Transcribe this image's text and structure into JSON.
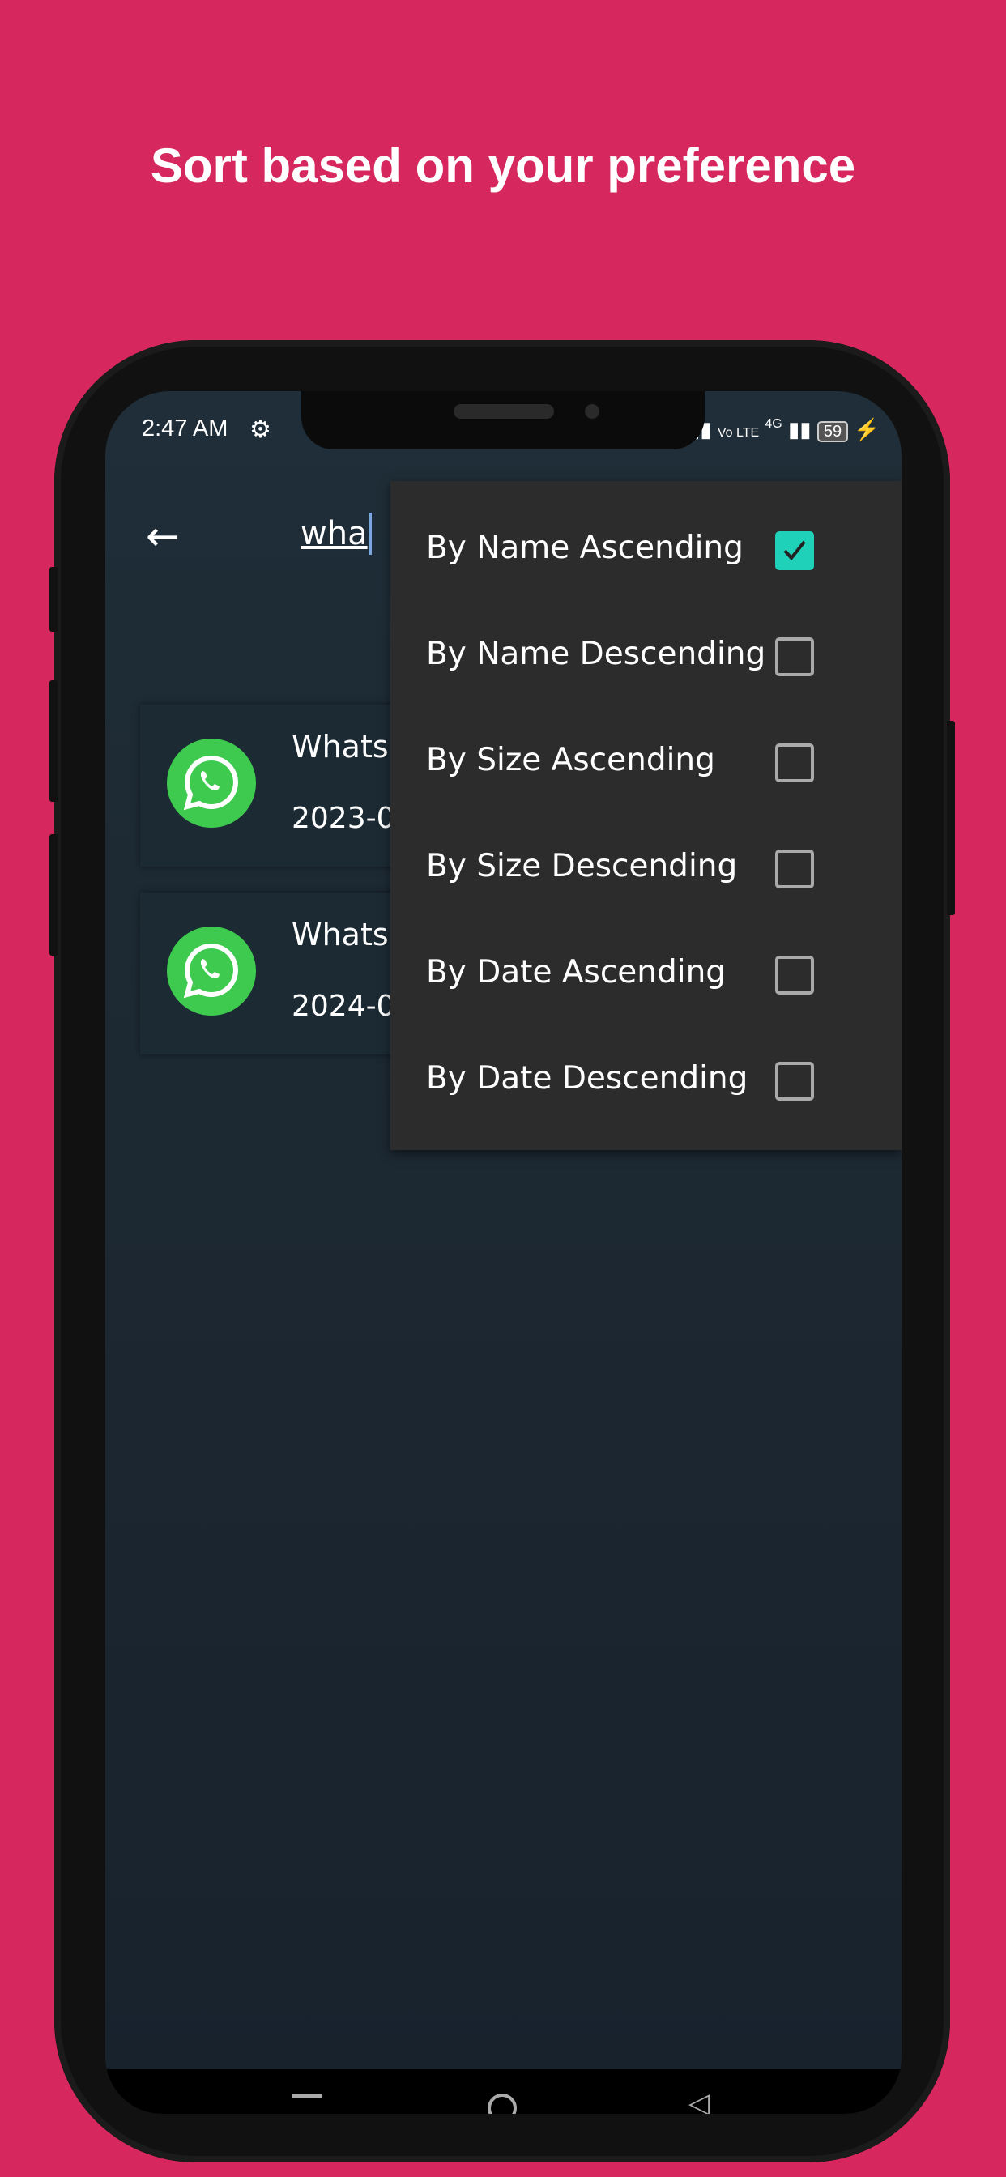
{
  "headline": "Sort based on your preference",
  "status": {
    "time": "2:47 AM",
    "network": "Vo LTE",
    "network_gen": "4G",
    "battery": "59"
  },
  "search": {
    "value": "wha"
  },
  "files": [
    {
      "name": "Whats.",
      "date": "2023-0"
    },
    {
      "name": "Whats.",
      "date": "2024-0"
    }
  ],
  "sort_menu": {
    "items": [
      {
        "label": "By Name Ascending",
        "checked": true
      },
      {
        "label": "By Name Descending",
        "checked": false
      },
      {
        "label": "By Size Ascending",
        "checked": false
      },
      {
        "label": "By Size Descending",
        "checked": false
      },
      {
        "label": "By Date Ascending",
        "checked": false
      },
      {
        "label": "By Date Descending",
        "checked": false
      }
    ]
  },
  "colors": {
    "background": "#D6285F",
    "accent": "#1fd1b8",
    "menu": "#2c2c2c",
    "whatsapp": "#3ec94f"
  }
}
